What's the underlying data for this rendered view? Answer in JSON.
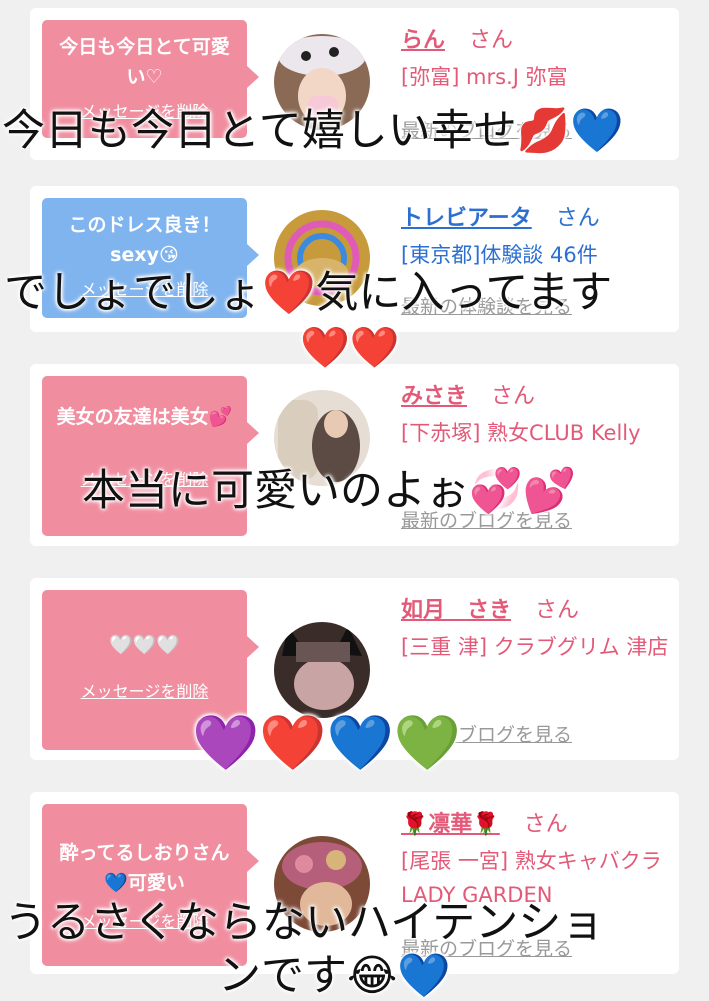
{
  "cards": [
    {
      "bubble_text": "今日も今日とて可愛い♡",
      "delete_label": "メッセージを削除",
      "name": "らん",
      "san": "さん",
      "shop": "[弥富] mrs.J 弥富",
      "blog": "最新のブログを見る"
    },
    {
      "bubble_text": "このドレス良き！sexy😘",
      "delete_label": "メッセージを削除",
      "name": "トレビアータ",
      "san": "さん",
      "shop": "[東京都]体験談 46件",
      "blog": "最新の体験談を見る"
    },
    {
      "bubble_text": "美女の友達は美女💕",
      "delete_label": "メッセージを削除",
      "name": "みさき",
      "san": "さん",
      "shop": "[下赤塚] 熟女CLUB Kelly",
      "blog": "最新のブログを見る"
    },
    {
      "bubble_text": "🤍🤍🤍",
      "delete_label": "メッセージを削除",
      "name": "如月　さき",
      "san": "さん",
      "shop": "[三重 津] クラブグリム 津店",
      "blog": "最新のブログを見る"
    },
    {
      "bubble_text": "酔ってるしおりさん💙可愛い",
      "delete_label": "メッセージを削除",
      "name": "🌹凛華🌹",
      "san": "さん",
      "shop": "[尾張 一宮] 熟女キャバクラ LADY GARDEN",
      "blog": "最新のブログを見る"
    }
  ],
  "overlays": {
    "caption1": "今日も今日とて嬉しい幸せ💋💙",
    "caption2a": "でしょでしょ",
    "caption2b": "❤️",
    "caption2c": "気に入ってます",
    "caption2d": "❤️❤️",
    "caption3": "本当に可愛いのよぉ💞💕",
    "caption4": "💜❤️💙💚",
    "caption5a": "うるさくならないハイテンショ",
    "caption5b": "ンです😂💙"
  },
  "colors": {
    "pink_accent": "#e35a78",
    "blue_accent": "#2c6fd1",
    "bubble_pink": "#f08ea0",
    "bubble_blue": "#80b4ee"
  }
}
